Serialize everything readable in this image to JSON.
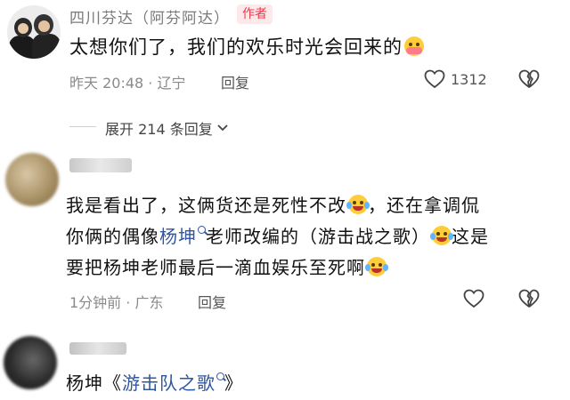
{
  "comments": [
    {
      "author": "四川芬达（阿芬阿达）",
      "badge": "作者",
      "text": "太想你们了，我们的欢乐时光会回来的",
      "emoji": "hugging-face-emoji",
      "time_location": "昨天 20:48 · 辽宁",
      "reply_label": "回复",
      "likes": "1312",
      "expand_label": "展开 214 条回复"
    },
    {
      "line1_a": "我是看出了，这俩货还是死性不改",
      "line1_b": "，还在拿调侃",
      "line2_a": "你俩的偶像",
      "line2_link": "杨坤",
      "line2_b": "老师改编的（游击战之歌）",
      "line2_c": "这是",
      "line3_a": "要把杨坤老师最后一滴血娱乐至死啊",
      "emoji": "crying-laughing-emoji",
      "time_location": "1分钟前 · 广东",
      "reply_label": "回复"
    },
    {
      "text_a": "杨坤《",
      "text_link": "游击队之歌",
      "text_b": "》"
    }
  ],
  "colors": {
    "link": "#2f56a0",
    "badge_bg": "#fde8ea",
    "badge_text": "#e8394d",
    "meta": "#8a8a8a"
  }
}
